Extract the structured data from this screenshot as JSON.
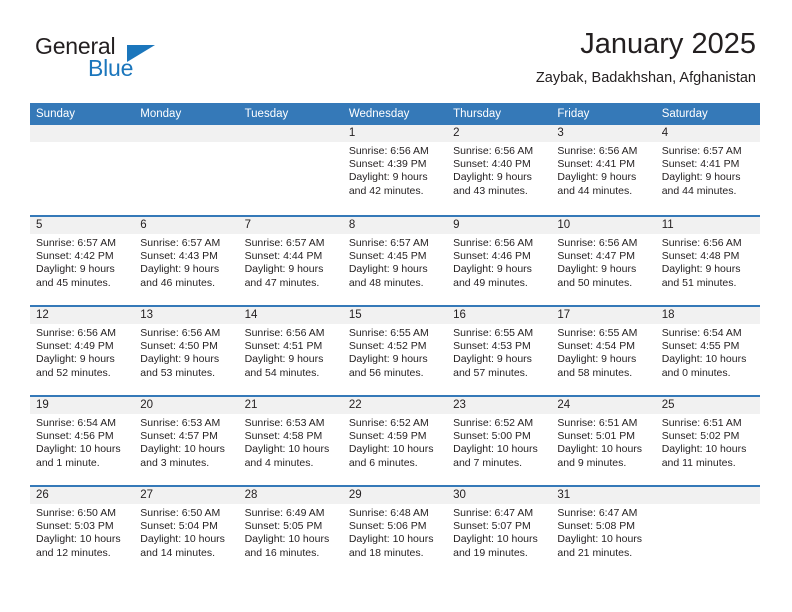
{
  "logo": {
    "word1": "General",
    "word2": "Blue",
    "triangle_color": "#1b76bc"
  },
  "header": {
    "title": "January 2025",
    "subtitle": "Zaybak, Badakhshan, Afghanistan"
  },
  "theme": {
    "header_blue": "#3579b8",
    "daynum_band": "#f1f1f1",
    "text": "#231f20",
    "logo_blue": "#1b76bc"
  },
  "weekdays": [
    "Sunday",
    "Monday",
    "Tuesday",
    "Wednesday",
    "Thursday",
    "Friday",
    "Saturday"
  ],
  "weeks": [
    [
      {
        "day": "",
        "empty": true,
        "sunrise": "",
        "sunset": "",
        "daylight1": "",
        "daylight2": ""
      },
      {
        "day": "",
        "empty": true,
        "sunrise": "",
        "sunset": "",
        "daylight1": "",
        "daylight2": ""
      },
      {
        "day": "",
        "empty": true,
        "sunrise": "",
        "sunset": "",
        "daylight1": "",
        "daylight2": ""
      },
      {
        "day": "1",
        "empty": false,
        "sunrise": "Sunrise: 6:56 AM",
        "sunset": "Sunset: 4:39 PM",
        "daylight1": "Daylight: 9 hours",
        "daylight2": "and 42 minutes."
      },
      {
        "day": "2",
        "empty": false,
        "sunrise": "Sunrise: 6:56 AM",
        "sunset": "Sunset: 4:40 PM",
        "daylight1": "Daylight: 9 hours",
        "daylight2": "and 43 minutes."
      },
      {
        "day": "3",
        "empty": false,
        "sunrise": "Sunrise: 6:56 AM",
        "sunset": "Sunset: 4:41 PM",
        "daylight1": "Daylight: 9 hours",
        "daylight2": "and 44 minutes."
      },
      {
        "day": "4",
        "empty": false,
        "sunrise": "Sunrise: 6:57 AM",
        "sunset": "Sunset: 4:41 PM",
        "daylight1": "Daylight: 9 hours",
        "daylight2": "and 44 minutes."
      }
    ],
    [
      {
        "day": "5",
        "empty": false,
        "sunrise": "Sunrise: 6:57 AM",
        "sunset": "Sunset: 4:42 PM",
        "daylight1": "Daylight: 9 hours",
        "daylight2": "and 45 minutes."
      },
      {
        "day": "6",
        "empty": false,
        "sunrise": "Sunrise: 6:57 AM",
        "sunset": "Sunset: 4:43 PM",
        "daylight1": "Daylight: 9 hours",
        "daylight2": "and 46 minutes."
      },
      {
        "day": "7",
        "empty": false,
        "sunrise": "Sunrise: 6:57 AM",
        "sunset": "Sunset: 4:44 PM",
        "daylight1": "Daylight: 9 hours",
        "daylight2": "and 47 minutes."
      },
      {
        "day": "8",
        "empty": false,
        "sunrise": "Sunrise: 6:57 AM",
        "sunset": "Sunset: 4:45 PM",
        "daylight1": "Daylight: 9 hours",
        "daylight2": "and 48 minutes."
      },
      {
        "day": "9",
        "empty": false,
        "sunrise": "Sunrise: 6:56 AM",
        "sunset": "Sunset: 4:46 PM",
        "daylight1": "Daylight: 9 hours",
        "daylight2": "and 49 minutes."
      },
      {
        "day": "10",
        "empty": false,
        "sunrise": "Sunrise: 6:56 AM",
        "sunset": "Sunset: 4:47 PM",
        "daylight1": "Daylight: 9 hours",
        "daylight2": "and 50 minutes."
      },
      {
        "day": "11",
        "empty": false,
        "sunrise": "Sunrise: 6:56 AM",
        "sunset": "Sunset: 4:48 PM",
        "daylight1": "Daylight: 9 hours",
        "daylight2": "and 51 minutes."
      }
    ],
    [
      {
        "day": "12",
        "empty": false,
        "sunrise": "Sunrise: 6:56 AM",
        "sunset": "Sunset: 4:49 PM",
        "daylight1": "Daylight: 9 hours",
        "daylight2": "and 52 minutes."
      },
      {
        "day": "13",
        "empty": false,
        "sunrise": "Sunrise: 6:56 AM",
        "sunset": "Sunset: 4:50 PM",
        "daylight1": "Daylight: 9 hours",
        "daylight2": "and 53 minutes."
      },
      {
        "day": "14",
        "empty": false,
        "sunrise": "Sunrise: 6:56 AM",
        "sunset": "Sunset: 4:51 PM",
        "daylight1": "Daylight: 9 hours",
        "daylight2": "and 54 minutes."
      },
      {
        "day": "15",
        "empty": false,
        "sunrise": "Sunrise: 6:55 AM",
        "sunset": "Sunset: 4:52 PM",
        "daylight1": "Daylight: 9 hours",
        "daylight2": "and 56 minutes."
      },
      {
        "day": "16",
        "empty": false,
        "sunrise": "Sunrise: 6:55 AM",
        "sunset": "Sunset: 4:53 PM",
        "daylight1": "Daylight: 9 hours",
        "daylight2": "and 57 minutes."
      },
      {
        "day": "17",
        "empty": false,
        "sunrise": "Sunrise: 6:55 AM",
        "sunset": "Sunset: 4:54 PM",
        "daylight1": "Daylight: 9 hours",
        "daylight2": "and 58 minutes."
      },
      {
        "day": "18",
        "empty": false,
        "sunrise": "Sunrise: 6:54 AM",
        "sunset": "Sunset: 4:55 PM",
        "daylight1": "Daylight: 10 hours",
        "daylight2": "and 0 minutes."
      }
    ],
    [
      {
        "day": "19",
        "empty": false,
        "sunrise": "Sunrise: 6:54 AM",
        "sunset": "Sunset: 4:56 PM",
        "daylight1": "Daylight: 10 hours",
        "daylight2": "and 1 minute."
      },
      {
        "day": "20",
        "empty": false,
        "sunrise": "Sunrise: 6:53 AM",
        "sunset": "Sunset: 4:57 PM",
        "daylight1": "Daylight: 10 hours",
        "daylight2": "and 3 minutes."
      },
      {
        "day": "21",
        "empty": false,
        "sunrise": "Sunrise: 6:53 AM",
        "sunset": "Sunset: 4:58 PM",
        "daylight1": "Daylight: 10 hours",
        "daylight2": "and 4 minutes."
      },
      {
        "day": "22",
        "empty": false,
        "sunrise": "Sunrise: 6:52 AM",
        "sunset": "Sunset: 4:59 PM",
        "daylight1": "Daylight: 10 hours",
        "daylight2": "and 6 minutes."
      },
      {
        "day": "23",
        "empty": false,
        "sunrise": "Sunrise: 6:52 AM",
        "sunset": "Sunset: 5:00 PM",
        "daylight1": "Daylight: 10 hours",
        "daylight2": "and 7 minutes."
      },
      {
        "day": "24",
        "empty": false,
        "sunrise": "Sunrise: 6:51 AM",
        "sunset": "Sunset: 5:01 PM",
        "daylight1": "Daylight: 10 hours",
        "daylight2": "and 9 minutes."
      },
      {
        "day": "25",
        "empty": false,
        "sunrise": "Sunrise: 6:51 AM",
        "sunset": "Sunset: 5:02 PM",
        "daylight1": "Daylight: 10 hours",
        "daylight2": "and 11 minutes."
      }
    ],
    [
      {
        "day": "26",
        "empty": false,
        "sunrise": "Sunrise: 6:50 AM",
        "sunset": "Sunset: 5:03 PM",
        "daylight1": "Daylight: 10 hours",
        "daylight2": "and 12 minutes."
      },
      {
        "day": "27",
        "empty": false,
        "sunrise": "Sunrise: 6:50 AM",
        "sunset": "Sunset: 5:04 PM",
        "daylight1": "Daylight: 10 hours",
        "daylight2": "and 14 minutes."
      },
      {
        "day": "28",
        "empty": false,
        "sunrise": "Sunrise: 6:49 AM",
        "sunset": "Sunset: 5:05 PM",
        "daylight1": "Daylight: 10 hours",
        "daylight2": "and 16 minutes."
      },
      {
        "day": "29",
        "empty": false,
        "sunrise": "Sunrise: 6:48 AM",
        "sunset": "Sunset: 5:06 PM",
        "daylight1": "Daylight: 10 hours",
        "daylight2": "and 18 minutes."
      },
      {
        "day": "30",
        "empty": false,
        "sunrise": "Sunrise: 6:47 AM",
        "sunset": "Sunset: 5:07 PM",
        "daylight1": "Daylight: 10 hours",
        "daylight2": "and 19 minutes."
      },
      {
        "day": "31",
        "empty": false,
        "sunrise": "Sunrise: 6:47 AM",
        "sunset": "Sunset: 5:08 PM",
        "daylight1": "Daylight: 10 hours",
        "daylight2": "and 21 minutes."
      },
      {
        "day": "",
        "empty": true,
        "sunrise": "",
        "sunset": "",
        "daylight1": "",
        "daylight2": ""
      }
    ]
  ]
}
